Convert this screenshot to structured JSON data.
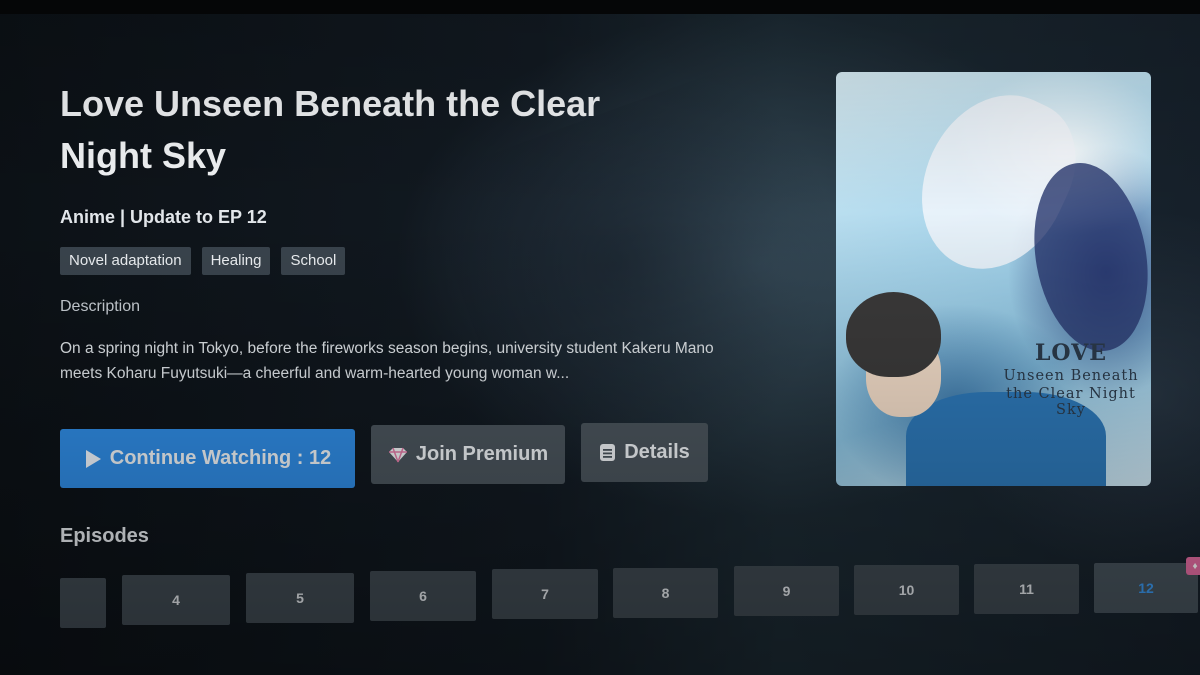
{
  "show": {
    "title": "Love Unseen Beneath the Clear Night Sky",
    "meta": "Anime | Update to EP 12",
    "tags": [
      "Novel adaptation",
      "Healing",
      "School"
    ],
    "description_label": "Description",
    "description": "On a spring night in Tokyo, before the fireworks season begins, university student Kakeru Mano meets Koharu Fuyutsuki—a cheerful and warm-hearted young woman w..."
  },
  "buttons": {
    "continue_label": "Continue Watching : 12",
    "premium_label": "Join Premium",
    "details_label": "Details"
  },
  "poster": {
    "logo_line1": "LOVE",
    "logo_line2": "Unseen Beneath",
    "logo_line3": "the Clear Night Sky"
  },
  "episodes": {
    "label": "Episodes",
    "items": [
      "",
      "4",
      "5",
      "6",
      "7",
      "8",
      "9",
      "10",
      "11",
      "12"
    ],
    "current": "12"
  },
  "colors": {
    "accent": "#2f8be3",
    "current_episode": "#3a98f0",
    "premium_badge": "#e66da3"
  }
}
